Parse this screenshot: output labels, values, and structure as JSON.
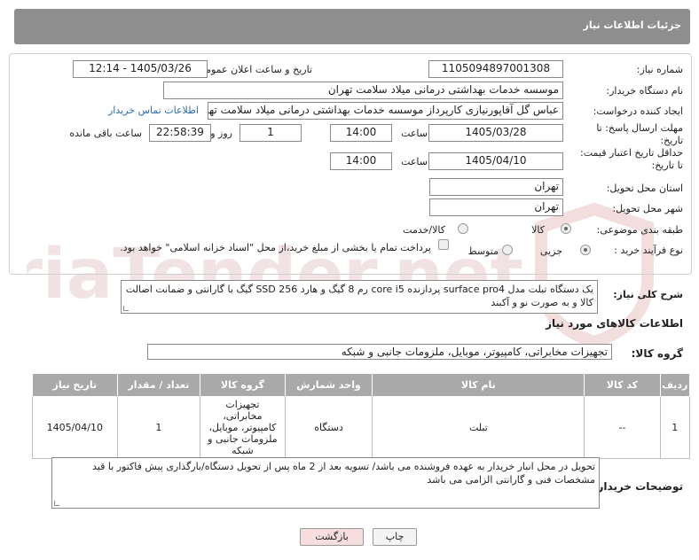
{
  "header": {
    "title": "جزئیات اطلاعات نیاز"
  },
  "form": {
    "need_number": {
      "label": "شماره نیاز:",
      "value": "1105094897001308"
    },
    "announce_datetime": {
      "label": "تاریخ و ساعت اعلان عمومی:",
      "value": "1405/03/26 - 12:14"
    },
    "buyer_org": {
      "label": "نام دستگاه خریدار:",
      "value": "موسسه خدمات بهداشتی درمانی میلاد سلامت تهران"
    },
    "requester": {
      "label": "ایجاد کننده درخواست:",
      "value": "عباس گل آقاپورنیازی کارپرداز موسسه خدمات بهداشتی درمانی میلاد سلامت تهران",
      "contact_link": "اطلاعات تماس خریدار"
    },
    "reply_deadline": {
      "label": "مهلت ارسال پاسخ: تا تاریخ:",
      "date": "1405/03/28",
      "time_label": "ساعت",
      "time": "14:00",
      "days": "1",
      "days_label": "روز و",
      "remaining": "22:58:39",
      "remaining_label": "ساعت باقی مانده"
    },
    "price_validity": {
      "label": "حداقل تاریخ اعتبار قیمت: تا تاریخ:",
      "date": "1405/04/10",
      "time_label": "ساعت",
      "time": "14:00"
    },
    "delivery_province": {
      "label": "استان محل تحویل:",
      "value": "تهران"
    },
    "delivery_city": {
      "label": "شهر محل تحویل:",
      "value": "تهران"
    },
    "category": {
      "label": "طبقه بندی موضوعی:",
      "options": [
        "کالا",
        "کالا/خدمت"
      ],
      "selected": "کالا"
    },
    "process_type": {
      "label": "نوع فرآیند خرید :",
      "options": [
        "جزیی",
        "متوسط"
      ],
      "selected": "جزیی",
      "payment_note": "پرداخت تمام یا بخشی از مبلغ خرید،از محل \"اسناد خزانه اسلامی\" خواهد بود."
    }
  },
  "general_description": {
    "label": "شرح کلی نیاز:",
    "value": "یک دستگاه تبلت مدل surface pro4  پردازنده core i5  رم 8 گیگ و هارد SSD 256  گیگ با گارانتی و ضمانت اصالت کالا و به صورت نو و آکبند"
  },
  "goods_info": {
    "title": "اطلاعات کالاهای مورد نیاز",
    "group_label": "گروه کالا:",
    "group_value": "تجهیزات مخابراتی، کامپیوتر، موبایل، ملزومات جانبی و شبکه",
    "columns": [
      "ردیف",
      "کد کالا",
      "نام کالا",
      "واحد شمارش",
      "گروه کالا",
      "تعداد / مقدار",
      "تاریخ نیاز"
    ],
    "rows": [
      {
        "row": "1",
        "code": "--",
        "name": "تبلت",
        "unit": "دستگاه",
        "group": "تجهیزات مخابراتی، کامپیوتر، موبایل، ملزومات جانبی و شبکه",
        "qty": "1",
        "date": "1405/04/10"
      }
    ]
  },
  "buyer_notes": {
    "label": "توضیحات خریدار:",
    "value": "تحویل در محل انبار خریدار به عهده فروشنده می باشد/ تسویه بعد از 2 ماه پس از تحویل دستگاه/بارگذاری پیش فاکتور با قید مشخصات فنی و گارانتی الزامی می باشد"
  },
  "buttons": {
    "print": "چاپ",
    "back": "بازگشت"
  },
  "watermark": {
    "text": "AriaTender.net"
  },
  "colors": {
    "header_bg": "#8e8e8e",
    "table_header_bg": "#a9a9a9",
    "link": "#2a6cb2",
    "back_btn_bg": "#f7dede"
  }
}
